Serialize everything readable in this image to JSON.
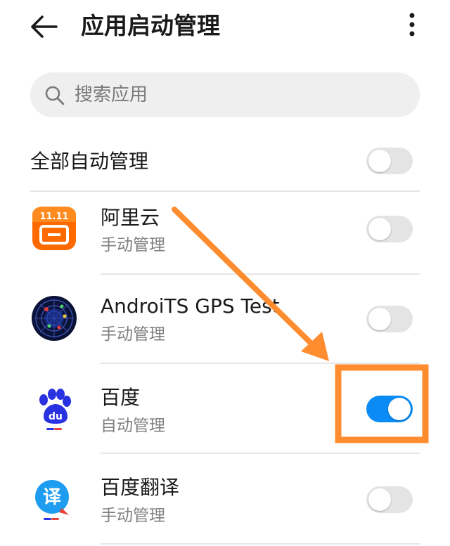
{
  "header": {
    "title": "应用启动管理",
    "back_icon": "back-arrow-icon",
    "more_icon": "more-vert-icon"
  },
  "search": {
    "placeholder": "搜索应用",
    "icon": "search-icon"
  },
  "all_auto": {
    "label": "全部自动管理",
    "enabled": false
  },
  "apps": [
    {
      "name": "阿里云",
      "status": "手动管理",
      "enabled": false,
      "icon": "aliyun-app-icon",
      "icon_badge": "11.11"
    },
    {
      "name": "AndroiTS GPS Test",
      "status": "手动管理",
      "enabled": false,
      "icon": "gps-test-app-icon"
    },
    {
      "name": "百度",
      "status": "自动管理",
      "enabled": true,
      "icon": "baidu-app-icon",
      "icon_badge": "du"
    },
    {
      "name": "百度翻译",
      "status": "手动管理",
      "enabled": false,
      "icon": "baidu-translate-app-icon",
      "icon_badge": "译"
    }
  ],
  "colors": {
    "toggle_on": "#0a8bf5",
    "toggle_off": "#e4e4e4",
    "annotation": "#ff8c2e",
    "aliyun_orange": "#ff6a00",
    "baidu_blue": "#2932e1"
  }
}
